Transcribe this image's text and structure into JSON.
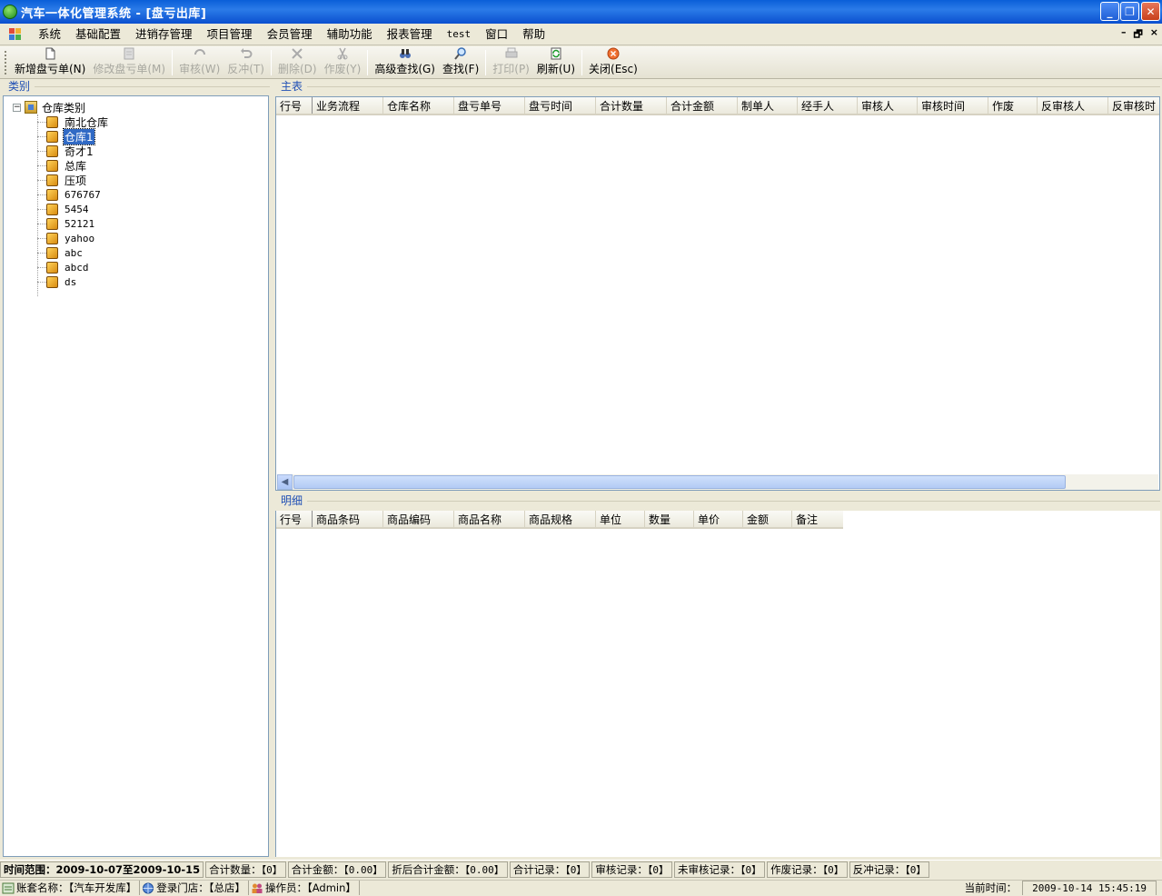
{
  "window": {
    "title": "汽车一体化管理系统 - [盘亏出库]",
    "controls": [
      "minimize",
      "restore",
      "close"
    ]
  },
  "menu": {
    "items": [
      "系统",
      "基础配置",
      "进销存管理",
      "项目管理",
      "会员管理",
      "辅助功能",
      "报表管理",
      "test",
      "窗口",
      "帮助"
    ],
    "mdi_controls": [
      "–",
      "🗗",
      "×"
    ]
  },
  "toolbar": {
    "buttons": [
      {
        "label": "新增盘亏单(N)",
        "icon": "new-document-icon",
        "enabled": true
      },
      {
        "label": "修改盘亏单(M)",
        "icon": "edit-document-icon",
        "enabled": false
      },
      {
        "label": "审核(W)",
        "icon": "approve-icon",
        "enabled": false
      },
      {
        "label": "反冲(T)",
        "icon": "undo-icon",
        "enabled": false
      },
      {
        "label": "删除(D)",
        "icon": "delete-icon",
        "enabled": false
      },
      {
        "label": "作废(Y)",
        "icon": "void-icon",
        "enabled": false
      },
      {
        "label": "高级查找(G)",
        "icon": "binoculars-icon",
        "enabled": true
      },
      {
        "label": "查找(F)",
        "icon": "magnifier-icon",
        "enabled": true
      },
      {
        "label": "打印(P)",
        "icon": "printer-icon",
        "enabled": false
      },
      {
        "label": "刷新(U)",
        "icon": "refresh-icon",
        "enabled": true
      },
      {
        "label": "关闭(Esc)",
        "icon": "close-circle-icon",
        "enabled": true
      }
    ]
  },
  "category": {
    "title": "类别",
    "root": "仓库类别",
    "items": [
      "南北仓库",
      "仓库1",
      "奇才1",
      "总库",
      "压项",
      "676767",
      "5454",
      "52121",
      "yahoo",
      "abc",
      "abcd",
      "ds"
    ],
    "selected": "仓库1"
  },
  "master": {
    "title": "主表",
    "columns": [
      "行号",
      "业务流程",
      "仓库名称",
      "盘亏单号",
      "盘亏时间",
      "合计数量",
      "合计金额",
      "制单人",
      "经手人",
      "审核人",
      "审核时间",
      "作废",
      "反审核人",
      "反审核时"
    ]
  },
  "detail": {
    "title": "明细",
    "columns": [
      "行号",
      "商品条码",
      "商品编码",
      "商品名称",
      "商品规格",
      "单位",
      "数量",
      "单价",
      "金额",
      "备注"
    ]
  },
  "status": {
    "time_range_label": "时间范围：",
    "time_range": "2009-10-07至2009-10-15",
    "total_qty_label": "合计数量：",
    "total_qty": "【0】",
    "total_amount_label": "合计金额：",
    "total_amount": "【0.00】",
    "discount_amount_label": "折后合计金额：",
    "discount_amount": "【0.00】",
    "total_records_label": "合计记录：",
    "total_records": "【0】",
    "approved_label": "审核记录：",
    "approved": "【0】",
    "unapproved_label": "未审核记录：",
    "unapproved": "【0】",
    "void_label": "作废记录：",
    "void": "【0】",
    "reversal_label": "反冲记录：",
    "reversal": "【0】"
  },
  "footer": {
    "account": "账套名称：【汽车开发库】",
    "store": "登录门店：【总店】",
    "operator": "操作员：【Admin】",
    "time_label": "当前时间：",
    "time": "2009-10-14 15:45:19"
  },
  "colors": {
    "title_gradient": "#0a5fd8",
    "selection": "#316ac5",
    "group_title": "#1f4fb5",
    "border": "#7f9db9"
  }
}
